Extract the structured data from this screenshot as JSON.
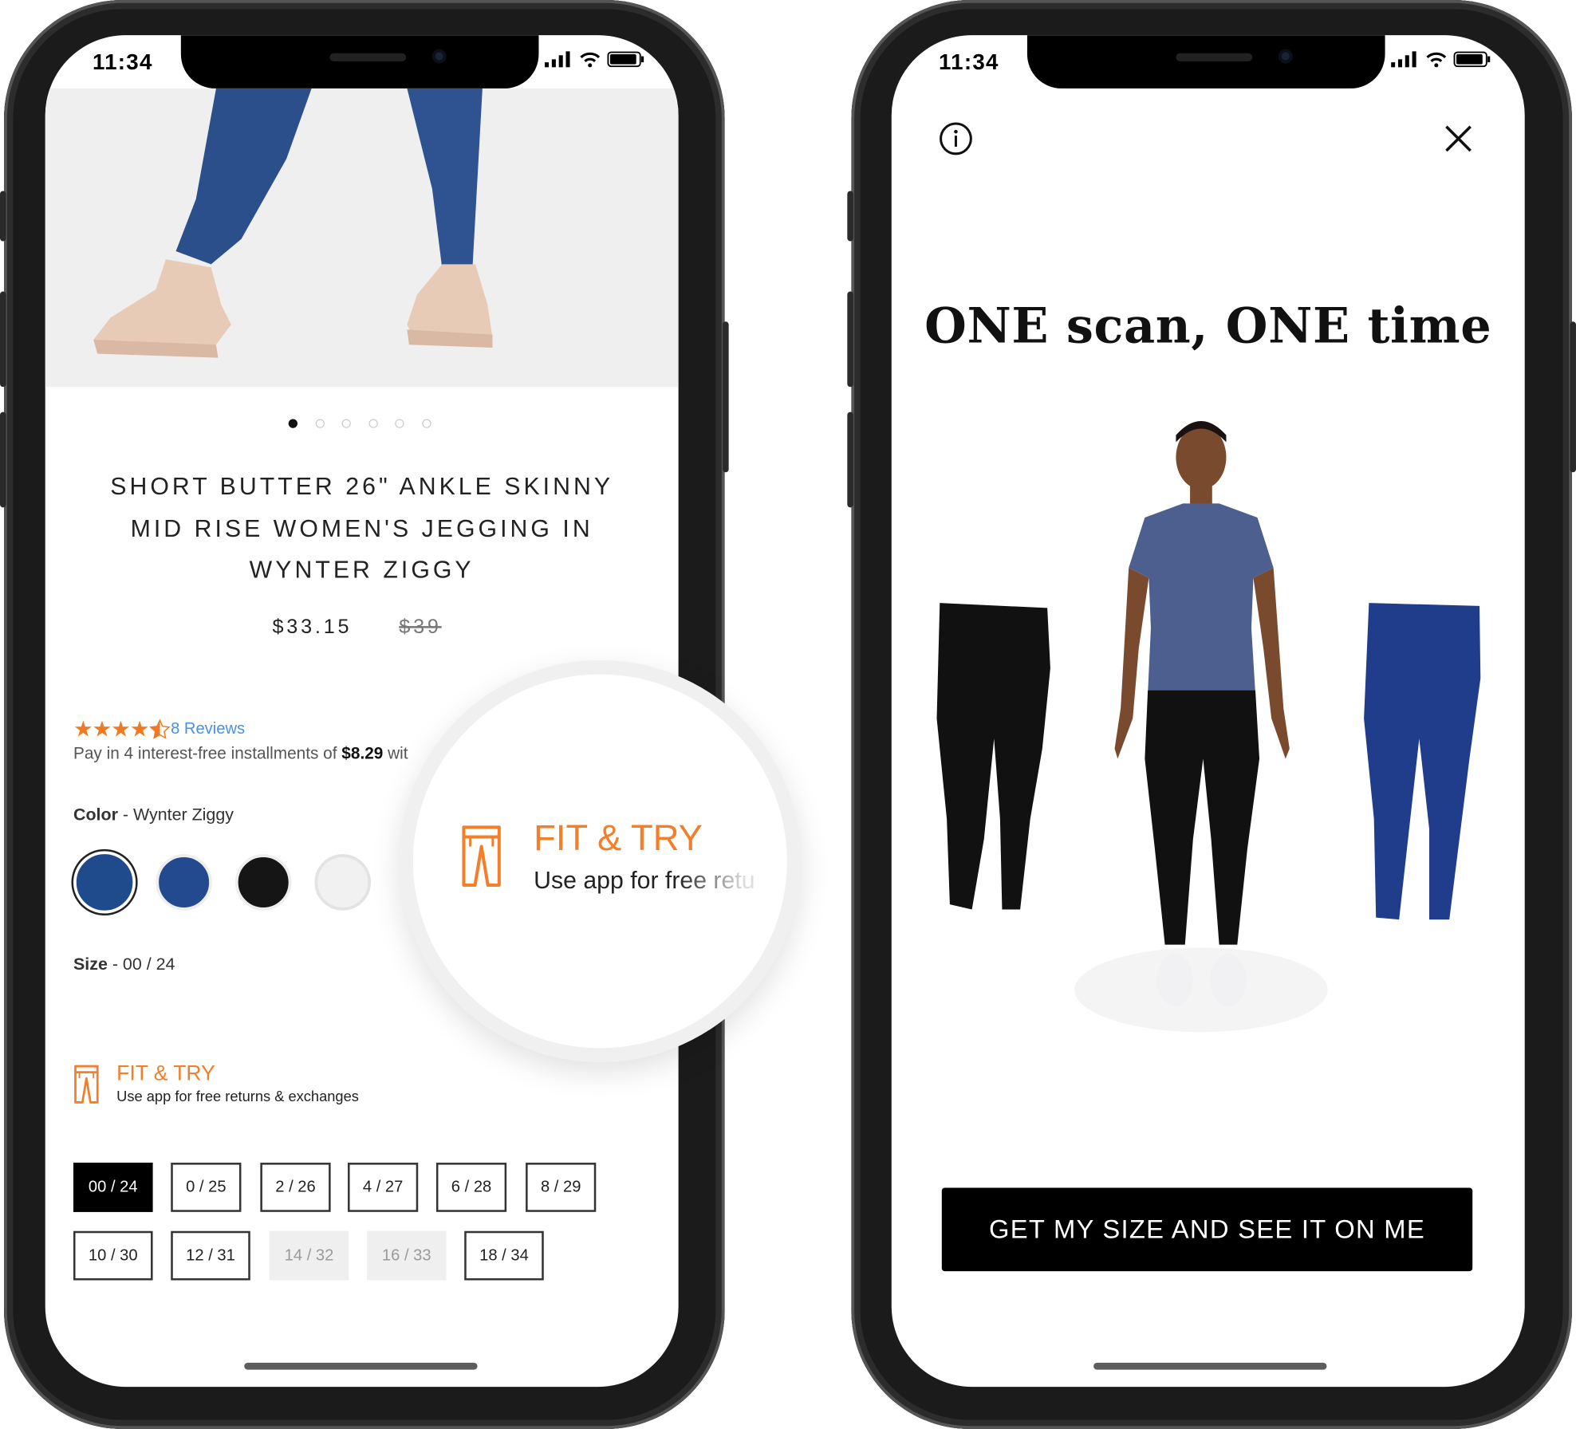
{
  "status_bar": {
    "time": "11:34"
  },
  "left_screen": {
    "carousel": {
      "count": 6,
      "active_index": 0
    },
    "product": {
      "title_lines": [
        "SHORT BUTTER 26\" ANKLE SKINNY",
        "MID RISE WOMEN'S JEGGING IN",
        "WYNTER ZIGGY"
      ],
      "price": "$33.15",
      "original_price": "$39"
    },
    "rating": {
      "stars": 4.5,
      "reviews_label": "8 Reviews"
    },
    "installments": {
      "prefix": "Pay in 4 interest-free installments of ",
      "amount": "$8.29",
      "suffix": " wit"
    },
    "color": {
      "label": "Color",
      "value": " - Wynter Ziggy",
      "swatches": [
        {
          "name": "Wynter Ziggy",
          "hex": "#1f4a8c",
          "selected": true
        },
        {
          "name": "Blue",
          "hex": "#23498f",
          "selected": false
        },
        {
          "name": "Black",
          "hex": "#151515",
          "selected": false
        },
        {
          "name": "White",
          "hex": "#f1f1f1",
          "selected": false
        }
      ]
    },
    "size": {
      "label": "Size",
      "value": "- 00 / 24",
      "options": [
        {
          "label": "00 / 24",
          "state": "selected"
        },
        {
          "label": "0 / 25",
          "state": "available"
        },
        {
          "label": "2 / 26",
          "state": "available"
        },
        {
          "label": "4 / 27",
          "state": "available"
        },
        {
          "label": "6 / 28",
          "state": "available"
        },
        {
          "label": "8 / 29",
          "state": "available"
        },
        {
          "label": "10 / 30",
          "state": "available"
        },
        {
          "label": "12 / 31",
          "state": "available"
        },
        {
          "label": "14 / 32",
          "state": "unavailable"
        },
        {
          "label": "16 / 33",
          "state": "unavailable"
        },
        {
          "label": "18 / 34",
          "state": "available"
        }
      ]
    },
    "fit_and_try": {
      "title": "FIT & TRY",
      "subtitle": "Use app for free returns & exchanges",
      "icon": "pants-icon"
    },
    "magnifier": {
      "title": "FIT & TRY",
      "subtitle": "Use app for free retu"
    }
  },
  "right_screen": {
    "headline": "ONE scan, ONE time",
    "cta_label": "GET MY SIZE AND SEE IT ON ME",
    "icons": {
      "info": "info-icon",
      "close": "close-icon"
    }
  },
  "colors": {
    "accent": "#f47f2a",
    "link": "#4a90e2",
    "star": "#ef7a22",
    "button": "#000000"
  }
}
